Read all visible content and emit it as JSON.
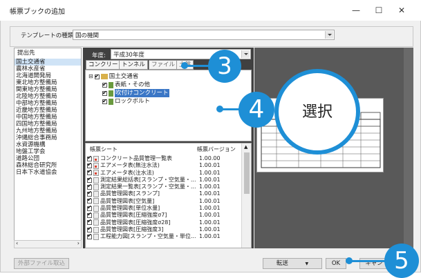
{
  "window": {
    "title": "帳票ブックの追加",
    "minimize": "—",
    "maximize": "☐",
    "close": "✕"
  },
  "template": {
    "label": "テンプレートの種類:",
    "value": "国の機関"
  },
  "submitter": {
    "header": "提出先",
    "items": [
      "国土交通省",
      "農林水産省",
      "北海道開発局",
      "東北地方整備局",
      "関東地方整備局",
      "北陸地方整備局",
      "中部地方整備局",
      "近畿地方整備局",
      "中国地方整備局",
      "四国地方整備局",
      "九州地方整備局",
      "沖縄総合事務局",
      "水資源機構",
      "地盤工学会",
      "道路公団",
      "森林総合研究所",
      "日本下水道協会"
    ],
    "selected_index": 0
  },
  "fiscal_year": {
    "label": "年度:",
    "value": "平成30年度"
  },
  "tabs": [
    "コンクリート",
    "トンネル",
    "ファイル",
    "土盤"
  ],
  "tree": {
    "root": "国土交通省",
    "children": [
      "表紙・その他",
      "吹付けコンクリート",
      "ロックボルト"
    ],
    "selected_child_index": 1
  },
  "sheets": {
    "col_name": "帳票シート",
    "col_version": "帳票バージョン",
    "rows": [
      {
        "name": "コンクリート品質管理一覧表",
        "version": "1.00.00"
      },
      {
        "name": "エアメータ表(無注水法)",
        "version": "1.00.01"
      },
      {
        "name": "エアメータ表(注水法)",
        "version": "1.00.01"
      },
      {
        "name": "測定結果総括表[スランプ・空気量・...",
        "version": "1.00.01"
      },
      {
        "name": "測定結果一覧表[スランプ・空気量・...",
        "version": "1.00.01"
      },
      {
        "name": "品質管理図表[スランプ]",
        "version": "1.00.01"
      },
      {
        "name": "品質管理図表[空気量]",
        "version": "1.00.01"
      },
      {
        "name": "品質管理図表[単位水量]",
        "version": "1.00.01"
      },
      {
        "name": "品質管理図表[圧縮強度σ7]",
        "version": "1.00.01"
      },
      {
        "name": "品質管理図表[圧縮強度σ28]",
        "version": "1.00.01"
      },
      {
        "name": "品質管理図表[圧縮強度3]",
        "version": "1.00.01"
      },
      {
        "name": "工程能力図[スランプ・空気量・単位...",
        "version": "1.00.01"
      }
    ]
  },
  "buttons": {
    "external_import": "外部ファイル取込",
    "transfer": "転送",
    "ok": "OK",
    "cancel": "キャン"
  },
  "callouts": {
    "step3": "3",
    "step4": "4",
    "step4_text": "選択",
    "step5": "5"
  },
  "colors": {
    "accent": "#1e8fd6",
    "selection": "#3b77c6"
  }
}
